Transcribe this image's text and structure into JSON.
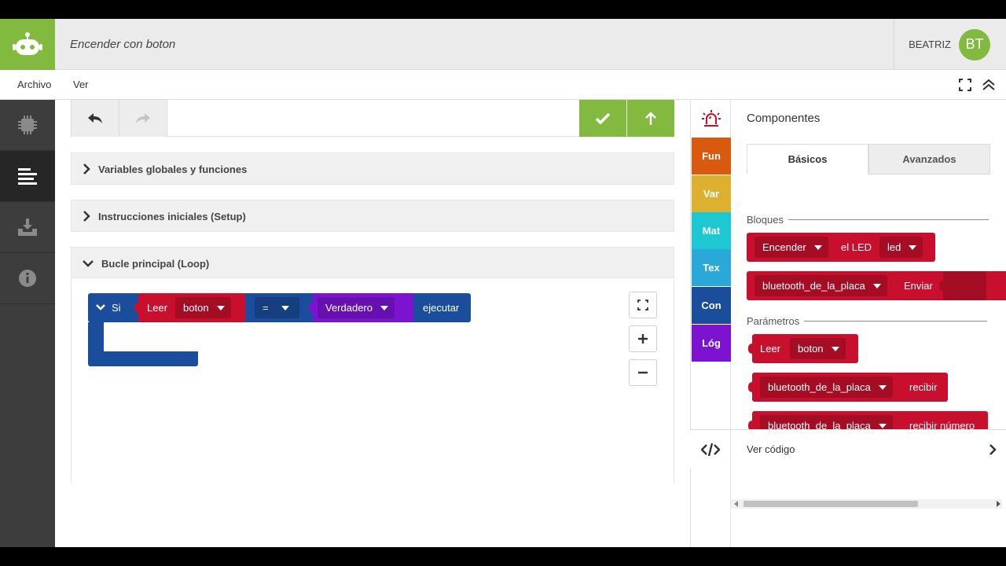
{
  "header": {
    "project_title": "Encender con boton",
    "user_name": "BEATRIZ",
    "avatar_initials": "BT"
  },
  "menu": {
    "archivo": "Archivo",
    "ver": "Ver"
  },
  "sections": {
    "globals": "Variables globales y funciones",
    "setup": "Instrucciones iniciales (Setup)",
    "loop": "Bucle principal (Loop)"
  },
  "blocks": {
    "if_label": "Si",
    "read_label": "Leer",
    "read_var": "boton",
    "operator": "=",
    "bool_value": "Verdadero",
    "exec_label": "ejecutar"
  },
  "categories": [
    {
      "label": "Fun",
      "color": "#d9590e"
    },
    {
      "label": "Var",
      "color": "#ddb12f"
    },
    {
      "label": "Mat",
      "color": "#1dc8d3"
    },
    {
      "label": "Tex",
      "color": "#2aa9d8"
    },
    {
      "label": "Con",
      "color": "#1a4d9b"
    },
    {
      "label": "Lóg",
      "color": "#7b13d1"
    }
  ],
  "components": {
    "title": "Componentes",
    "tab_basic": "Básicos",
    "tab_advanced": "Avanzados",
    "group_blocks": "Bloques",
    "group_params": "Parámetros",
    "block_led_action": "Encender",
    "block_led_label": "el LED",
    "block_led_var": "led",
    "block_bt_var": "bluetooth_de_la_placa",
    "block_bt_send": "Enviar",
    "param_read": "Leer",
    "param_read_var": "boton",
    "param_bt_receive": "recibir",
    "param_bt_receive_num": "recibir número"
  },
  "code_bar": {
    "label": "Ver código"
  },
  "colors": {
    "green": "#82ba3f",
    "red_block": "#c8102e",
    "blue_block": "#1a4d9b",
    "purple_block": "#7b13d1"
  }
}
